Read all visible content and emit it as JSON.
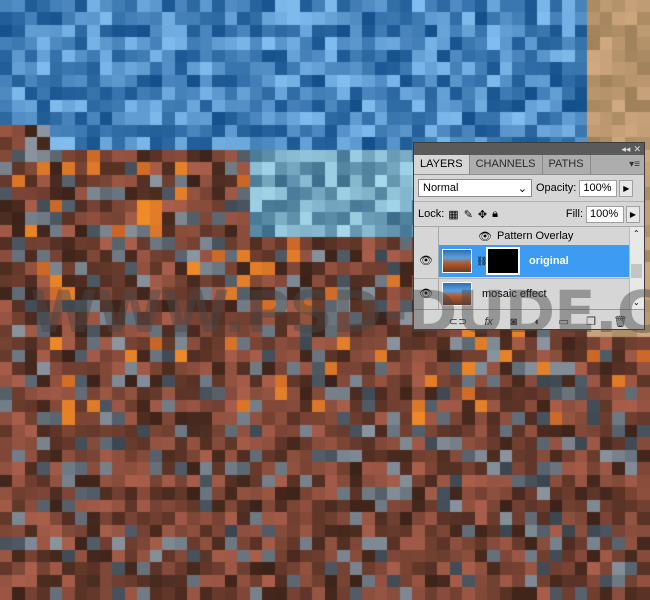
{
  "watermark": "WWW.PSD-DUDE.COM",
  "panel": {
    "titlebar": {
      "collapse_icon": "double-left-arrow",
      "close_icon": "close-x"
    },
    "tabs": [
      {
        "label": "LAYERS",
        "active": true
      },
      {
        "label": "CHANNELS",
        "active": false
      },
      {
        "label": "PATHS",
        "active": false
      }
    ],
    "blend_mode": "Normal",
    "opacity_label": "Opacity:",
    "opacity_value": "100%",
    "lock_label": "Lock:",
    "fill_label": "Fill:",
    "fill_value": "100%",
    "effect_row": "Pattern Overlay",
    "layers": [
      {
        "name": "original",
        "selected": true,
        "visible": true,
        "has_mask": true
      },
      {
        "name": "mosaic effect",
        "selected": false,
        "visible": true,
        "has_mask": false
      }
    ],
    "selection_color": "#3e9bf2",
    "bottom_tools": [
      "link-layers",
      "add-layer-style",
      "add-mask",
      "adjustment-layer",
      "new-group",
      "new-layer",
      "delete-layer"
    ]
  }
}
